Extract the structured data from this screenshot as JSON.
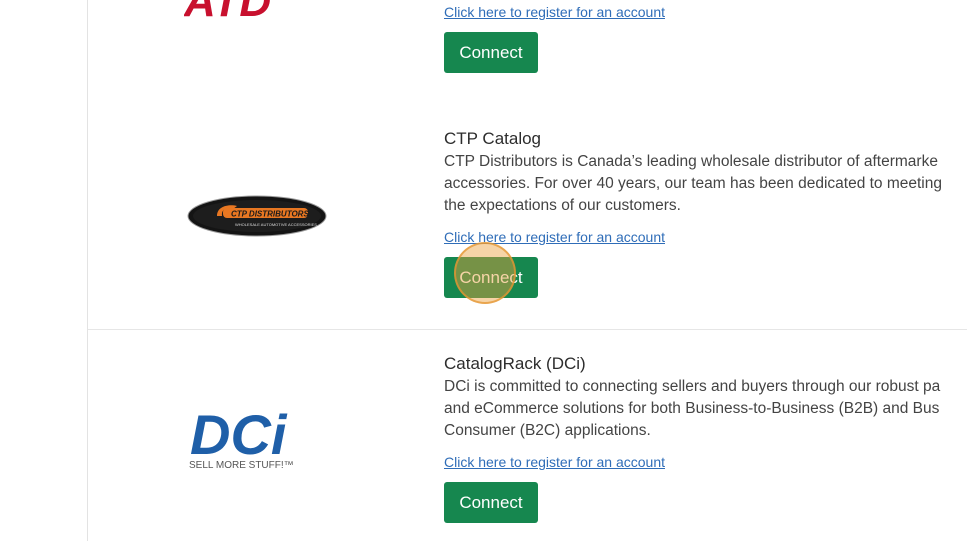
{
  "rows": [
    {
      "logo_text": "ATD",
      "register_link": "Click here to register for an account",
      "connect_label": "Connect"
    },
    {
      "title": "CTP Catalog",
      "description_lines": [
        "CTP Distributors is Canada’s leading wholesale distributor of aftermarke",
        "accessories. For over 40 years, our team has been dedicated to meeting",
        "the expectations of our customers."
      ],
      "logo_text": "CTP DISTRIBUTORS",
      "logo_subtext": "WHOLESALE AUTOMOTIVE ACCESSORIES",
      "register_link": "Click here to register for an account",
      "connect_label": "Connect"
    },
    {
      "title": "CatalogRack (DCi)",
      "description_lines": [
        "DCi is committed to connecting sellers and buyers through our robust pa",
        "and eCommerce solutions for both Business-to-Business (B2B) and Bus",
        "Consumer (B2C) applications."
      ],
      "logo_text": "DCi",
      "logo_subtext": "SELL MORE STUFF!™",
      "register_link": "Click here to register for an account",
      "connect_label": "Connect"
    }
  ],
  "colors": {
    "connect_button": "#16874f",
    "link": "#2f6db8",
    "atd_red": "#c8102e",
    "dci_blue": "#1f5fa8",
    "ctp_orange": "#e87722"
  }
}
